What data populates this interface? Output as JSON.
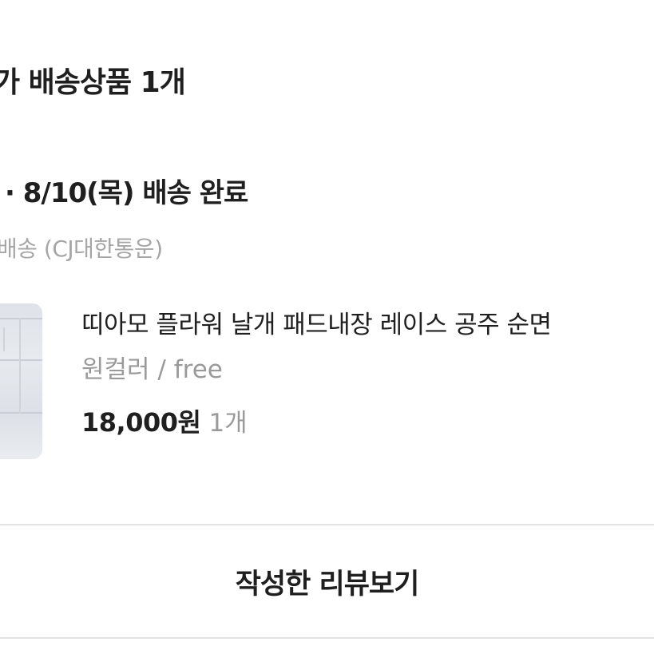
{
  "order": {
    "section_title": "가 배송상품 1개",
    "delivery_status": "· 8/10(목) 배송 완료",
    "carrier": "배송 (CJ대한통운)"
  },
  "product": {
    "name": "띠아모 플라워 날개 패드내장 레이스 공주 순면",
    "option": "원컬러 / free",
    "price": "18,000원",
    "quantity": "1개"
  },
  "actions": {
    "review_label": "작성한 리뷰보기"
  },
  "colors": {
    "text_primary": "#1f1f1f",
    "text_secondary": "#9a9a9a",
    "divider": "#e4e4e4",
    "background": "#ffffff"
  }
}
